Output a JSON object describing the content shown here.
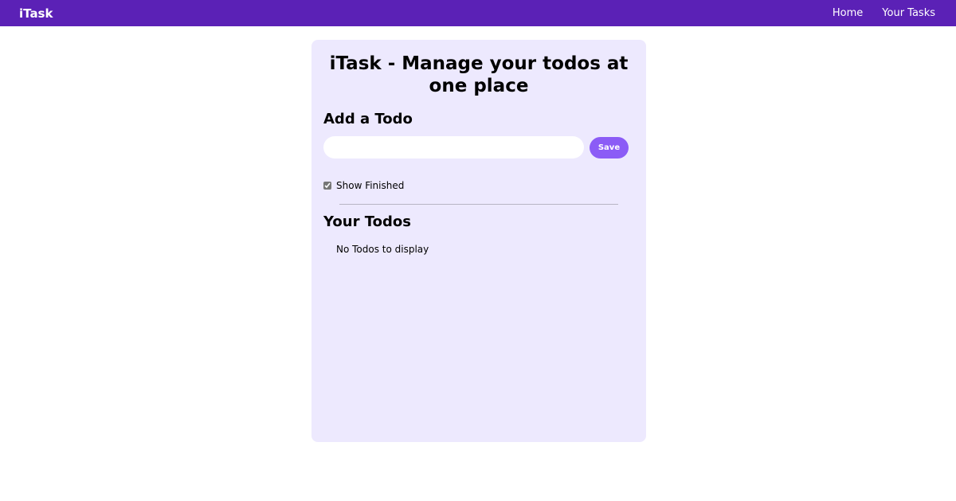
{
  "navbar": {
    "brand": "iTask",
    "links": [
      "Home",
      "Your Tasks"
    ]
  },
  "main": {
    "title": "iTask - Manage your todos at one place",
    "add_heading": "Add a Todo",
    "input_value": "",
    "save_label": "Save",
    "show_finished_label": "Show Finished",
    "show_finished_checked": true,
    "todos_heading": "Your Todos",
    "empty_message": "No Todos to display"
  },
  "colors": {
    "navbar": "#5b21b6",
    "panel": "#ede9fe",
    "accent": "#8b5cf6"
  }
}
